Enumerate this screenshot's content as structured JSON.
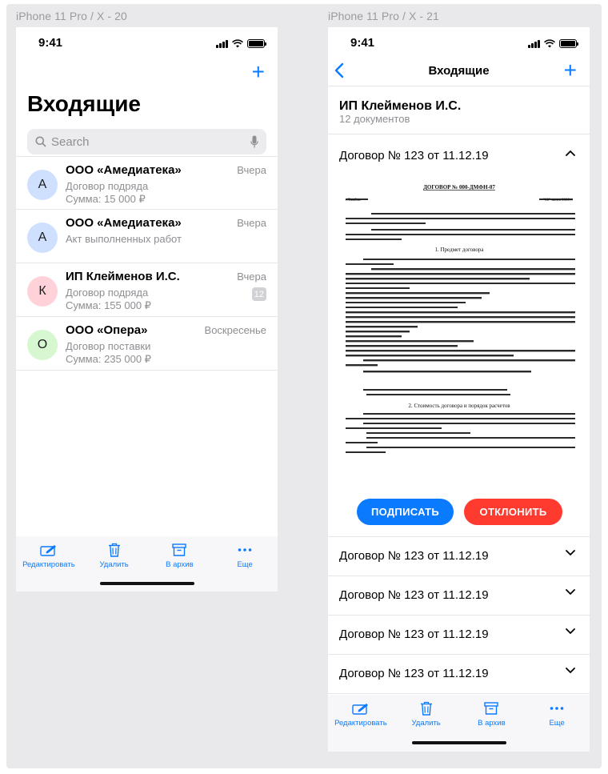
{
  "frames": {
    "left_label": "iPhone 11 Pro / X - 20",
    "right_label": "iPhone 11 Pro / X - 21"
  },
  "status": {
    "time": "9:41"
  },
  "inbox": {
    "title": "Входящие",
    "search_placeholder": "Search",
    "items": [
      {
        "initial": "А",
        "sender": "ООО «Амедиатека»",
        "date": "Вчера",
        "line1": "Договор подряда",
        "line2": "Сумма: 15 000 ₽",
        "badge": "",
        "avatar_color": "#cfe0ff"
      },
      {
        "initial": "А",
        "sender": "ООО «Амедиатека»",
        "date": "Вчера",
        "line1": "Акт выполненных работ",
        "line2": "",
        "badge": "",
        "avatar_color": "#cfe0ff"
      },
      {
        "initial": "К",
        "sender": "ИП Клейменов И.С.",
        "date": "Вчера",
        "line1": "Договор подряда",
        "line2": "Сумма: 155 000 ₽",
        "badge": "12",
        "avatar_color": "#ffd2da"
      },
      {
        "initial": "О",
        "sender": "ООО «Опера»",
        "date": "Воскресенье",
        "line1": "Договор поставки",
        "line2": "Сумма: 235 000 ₽",
        "badge": "",
        "avatar_color": "#d6f7cf"
      }
    ]
  },
  "tabbar": {
    "edit": "Редактировать",
    "delete": "Удалить",
    "archive": "В архив",
    "more": "Еще"
  },
  "detail": {
    "nav_title": "Входящие",
    "sender": "ИП Клейменов И.С.",
    "doc_count": "12 документов",
    "expanded_title": "Договор № 123 от 11.12.19",
    "collapsed": [
      "Договор № 123 от 11.12.19",
      "Договор № 123 от 11.12.19",
      "Договор № 123 от 11.12.19",
      "Договор № 123 от 11.12.19"
    ],
    "sign_label": "ПОДПИСАТЬ",
    "reject_label": "ОТКЛОНИТЬ"
  },
  "document": {
    "heading": "ДОГОВОР № 000-ДМФН-07",
    "city": "г.Тамбов",
    "date": "\"00\" июня 0000 г.",
    "section1": "1. Предмет договора",
    "section2": "2. Стоимость договора и порядок расчетов"
  },
  "colors": {
    "accent": "#0a7aff",
    "sign": "#0a7aff",
    "reject": "#ff3b30",
    "background": "#e9e9ec"
  }
}
